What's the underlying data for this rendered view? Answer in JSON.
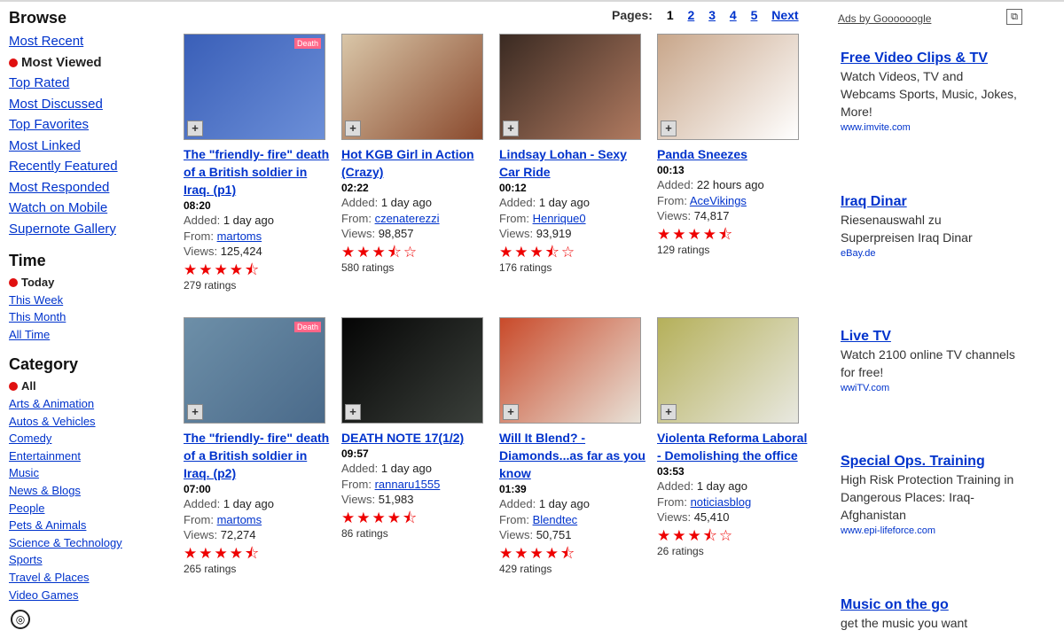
{
  "sidebar": {
    "browse": {
      "heading": "Browse",
      "items": [
        {
          "label": "Most Recent",
          "active": false
        },
        {
          "label": "Most Viewed",
          "active": true
        },
        {
          "label": "Top Rated",
          "active": false
        },
        {
          "label": "Most Discussed",
          "active": false
        },
        {
          "label": "Top Favorites",
          "active": false
        },
        {
          "label": "Most Linked",
          "active": false
        },
        {
          "label": "Recently Featured",
          "active": false
        },
        {
          "label": "Most Responded",
          "active": false
        },
        {
          "label": "Watch on Mobile",
          "active": false
        },
        {
          "label": "Supernote Gallery",
          "active": false
        }
      ]
    },
    "time": {
      "heading": "Time",
      "items": [
        {
          "label": "Today",
          "active": true
        },
        {
          "label": "This Week",
          "active": false
        },
        {
          "label": "This Month",
          "active": false
        },
        {
          "label": "All Time",
          "active": false
        }
      ]
    },
    "category": {
      "heading": "Category",
      "items": [
        {
          "label": "All",
          "active": true
        },
        {
          "label": "Arts & Animation",
          "active": false
        },
        {
          "label": "Autos & Vehicles",
          "active": false
        },
        {
          "label": "Comedy",
          "active": false
        },
        {
          "label": "Entertainment",
          "active": false
        },
        {
          "label": "Music",
          "active": false
        },
        {
          "label": "News & Blogs",
          "active": false
        },
        {
          "label": "People",
          "active": false
        },
        {
          "label": "Pets & Animals",
          "active": false
        },
        {
          "label": "Science & Technology",
          "active": false
        },
        {
          "label": "Sports",
          "active": false
        },
        {
          "label": "Travel & Places",
          "active": false
        },
        {
          "label": "Video Games",
          "active": false
        }
      ]
    }
  },
  "pager": {
    "label": "Pages:",
    "current": "1",
    "pages": [
      "2",
      "3",
      "4",
      "5"
    ],
    "next": "Next"
  },
  "labels": {
    "added": "Added:",
    "from": "From:",
    "views": "Views:",
    "ratings_suffix": "ratings"
  },
  "videos": [
    {
      "title": "The \"friendly- fire\" death of a British soldier in Iraq. (p1)",
      "duration": "08:20",
      "added": "1 day ago",
      "from": "martoms",
      "views": "125,424",
      "stars": "★★★★⯪",
      "ratings": "279",
      "thumb_colors": [
        "#3a5fb8",
        "#6c8fd8"
      ],
      "thumb_tag": "Death"
    },
    {
      "title": "Hot KGB Girl in Action (Crazy)",
      "duration": "02:22",
      "added": "1 day ago",
      "from": "czenaterezzi",
      "views": "98,857",
      "stars": "★★★⯪☆",
      "ratings": "580",
      "thumb_colors": [
        "#d9c6a8",
        "#8a4a2e"
      ],
      "thumb_tag": ""
    },
    {
      "title": "Lindsay Lohan - Sexy Car Ride",
      "duration": "00:12",
      "added": "1 day ago",
      "from": "Henrique0",
      "views": "93,919",
      "stars": "★★★⯪☆",
      "ratings": "176",
      "thumb_colors": [
        "#3a2a22",
        "#b07a60"
      ],
      "thumb_tag": ""
    },
    {
      "title": "Panda Sneezes",
      "duration": "00:13",
      "added": "22 hours ago",
      "from": "AceVikings",
      "views": "74,817",
      "stars": "★★★★⯪",
      "ratings": "129",
      "thumb_colors": [
        "#c8a68a",
        "#ffffff"
      ],
      "thumb_tag": ""
    },
    {
      "title": "The \"friendly- fire\" death of a British soldier in Iraq. (p2)",
      "duration": "07:00",
      "added": "1 day ago",
      "from": "martoms",
      "views": "72,274",
      "stars": "★★★★⯪",
      "ratings": "265",
      "thumb_colors": [
        "#6d8fa8",
        "#4a6a8a"
      ],
      "thumb_tag": "Death"
    },
    {
      "title": "DEATH NOTE 17(1/2)",
      "duration": "09:57",
      "added": "1 day ago",
      "from": "rannaru1555",
      "views": "51,983",
      "stars": "★★★★⯪",
      "ratings": "86",
      "thumb_colors": [
        "#050505",
        "#3a3f3a"
      ],
      "thumb_tag": ""
    },
    {
      "title": "Will It Blend? - Diamonds...as far as you know",
      "duration": "01:39",
      "added": "1 day ago",
      "from": "Blendtec",
      "views": "50,751",
      "stars": "★★★★⯪",
      "ratings": "429",
      "thumb_colors": [
        "#c94a2a",
        "#e8e2d8"
      ],
      "thumb_tag": ""
    },
    {
      "title": "Violenta Reforma Laboral - Demolishing the office",
      "duration": "03:53",
      "added": "1 day ago",
      "from": "noticiasblog",
      "views": "45,410",
      "stars": "★★★⯪☆",
      "ratings": "26",
      "thumb_colors": [
        "#b5b05a",
        "#e8e8e0"
      ],
      "thumb_tag": ""
    }
  ],
  "ads": {
    "ads_by": "Ads by Goooooogle",
    "items": [
      {
        "title": "Free Video Clips & TV",
        "desc": "Watch Videos, TV and Webcams Sports, Music, Jokes, More!",
        "url": "www.imvite.com"
      },
      {
        "title": "Iraq Dinar",
        "desc": "Riesenauswahl zu Superpreisen Iraq Dinar",
        "url": "eBay.de"
      },
      {
        "title": "Live TV",
        "desc": "Watch 2100 online TV channels for free!",
        "url": "wwiTV.com"
      },
      {
        "title": "Special Ops. Training",
        "desc": "High Risk Protection Training in Dangerous Places: Iraq-Afghanistan",
        "url": "www.epi-lifeforce.com"
      },
      {
        "title": "Music on the go",
        "desc": "get the music you want",
        "url": ""
      }
    ]
  }
}
